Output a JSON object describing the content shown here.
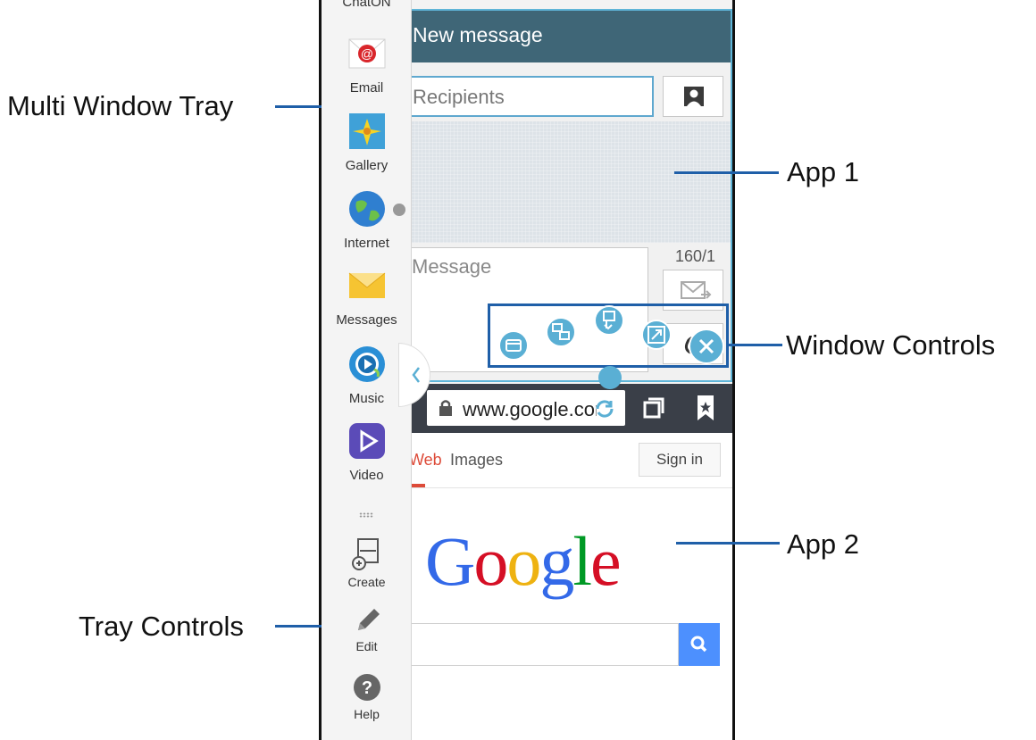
{
  "callouts": {
    "multi_window_tray": "Multi Window Tray",
    "app1": "App 1",
    "window_controls": "Window Controls",
    "app2": "App 2",
    "tray_controls": "Tray Controls"
  },
  "tray": {
    "items": [
      {
        "label": "Email",
        "icon": "email-icon"
      },
      {
        "label": "Gallery",
        "icon": "gallery-icon"
      },
      {
        "label": "Internet",
        "icon": "internet-icon"
      },
      {
        "label": "Messages",
        "icon": "messages-icon"
      },
      {
        "label": "Music",
        "icon": "music-icon"
      },
      {
        "label": "Video",
        "icon": "video-icon"
      }
    ],
    "controls": [
      {
        "label": "Create",
        "icon": "create-icon"
      },
      {
        "label": "Edit",
        "icon": "pencil-icon"
      },
      {
        "label": "Help",
        "icon": "help-icon"
      }
    ]
  },
  "app1": {
    "title": "New message",
    "recipients_placeholder": "Recipients",
    "compose_placeholder": "Message",
    "char_count": "160/1"
  },
  "app2": {
    "url": "www.google.com",
    "tabs": [
      "Web",
      "Images"
    ],
    "sign_in": "Sign in",
    "logo": "Google"
  },
  "colors": {
    "callout_blue": "#1f5fa8",
    "app1_header": "#3f6677",
    "window_control": "#5aafd4",
    "browser_toolbar": "#3a3f48",
    "google_red": "#dd4b39",
    "search_blue": "#4d90fe"
  }
}
